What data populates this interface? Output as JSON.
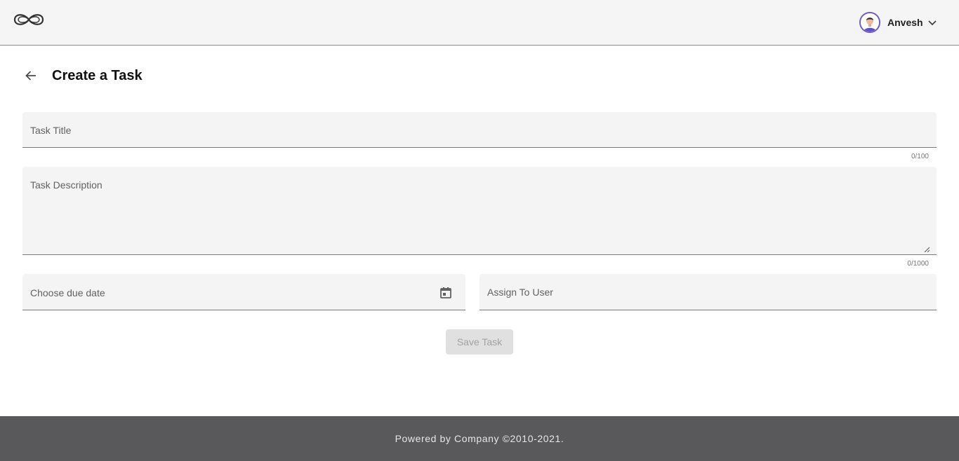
{
  "header": {
    "logo_icon": "infinity-logo-icon",
    "user": {
      "name": "Anvesh",
      "avatar_icon": "user-avatar-icon",
      "menu_icon": "chevron-down-icon"
    }
  },
  "page": {
    "title": "Create a Task",
    "back_icon": "arrow-back-icon"
  },
  "form": {
    "task_title": {
      "label": "Task Title",
      "value": "",
      "counter": "0/100"
    },
    "task_description": {
      "label": "Task Description",
      "value": "",
      "counter": "0/1000"
    },
    "due_date": {
      "label": "Choose due date",
      "value": "",
      "icon": "calendar-icon"
    },
    "assign_user": {
      "label": "Assign To User",
      "value": ""
    },
    "save_label": "Save Task"
  },
  "footer": {
    "text": "Powered by Company ©2010-2021."
  },
  "colors": {
    "header_bg": "#f5f5f5",
    "field_bg": "#f4f4f4",
    "footer_bg": "#59595b",
    "disabled_button": "#e0e0e0",
    "avatar_ring": "#6a5acd"
  }
}
